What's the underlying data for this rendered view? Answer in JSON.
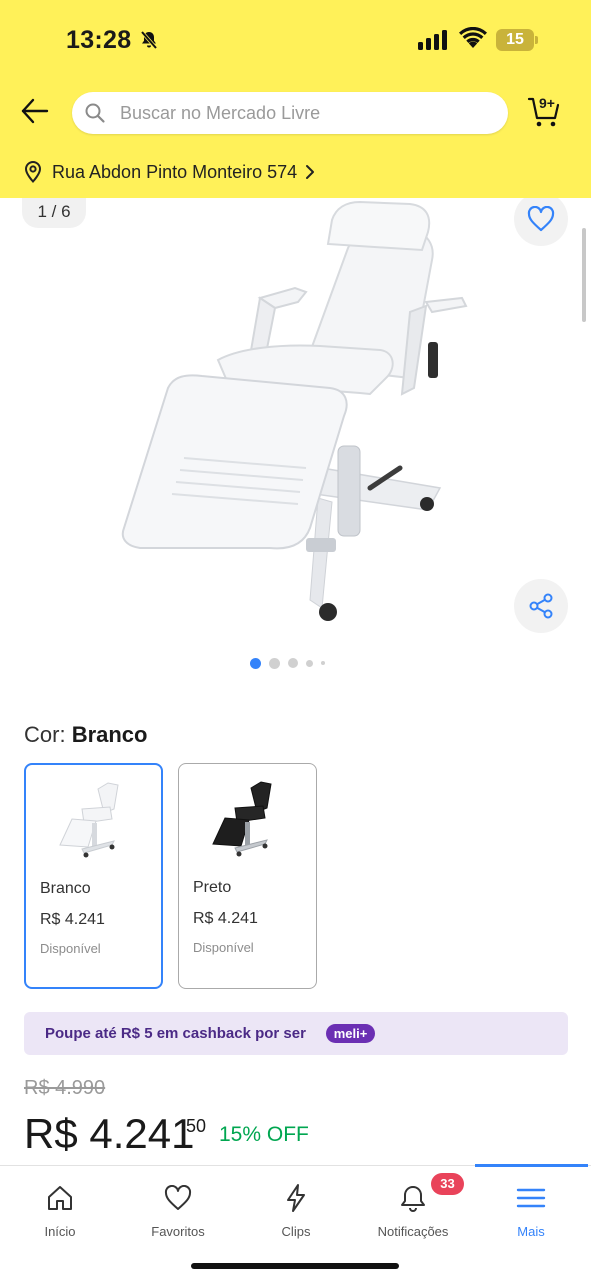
{
  "status_bar": {
    "time": "13:28",
    "battery": "15",
    "icons": [
      "bell-off-icon",
      "signal-icon",
      "wifi-icon",
      "battery-icon"
    ]
  },
  "header": {
    "search_placeholder": "Buscar no Mercado Livre",
    "cart_count": "9+",
    "location": "Rua Abdon Pinto Monteiro 574",
    "background_color": "#fff159"
  },
  "gallery": {
    "counter": "1 / 6",
    "dots_count": 5,
    "active_dot": 1,
    "accent_color": "#3483fa"
  },
  "color_selector": {
    "label": "Cor:",
    "selected": "Branco",
    "variants": [
      {
        "name": "Branco",
        "price": "R$ 4.241",
        "status": "Disponível",
        "selected": true
      },
      {
        "name": "Preto",
        "price": "R$ 4.241",
        "status": "Disponível",
        "selected": false
      }
    ]
  },
  "cashback": {
    "text": "Poupe até R$ 5 em cashback por ser",
    "badge": "meli+"
  },
  "price": {
    "old": "R$ 4.990",
    "current": "R$ 4.241",
    "cents": "50",
    "discount": "15% OFF",
    "discount_color": "#00a650"
  },
  "bottom_nav": {
    "items": [
      {
        "label": "Início",
        "icon": "home-icon"
      },
      {
        "label": "Favoritos",
        "icon": "heart-icon"
      },
      {
        "label": "Clips",
        "icon": "clips-icon"
      },
      {
        "label": "Notificações",
        "icon": "bell-icon"
      },
      {
        "label": "Mais",
        "icon": "menu-icon"
      }
    ],
    "active": "Mais",
    "notifications_badge": "33"
  }
}
